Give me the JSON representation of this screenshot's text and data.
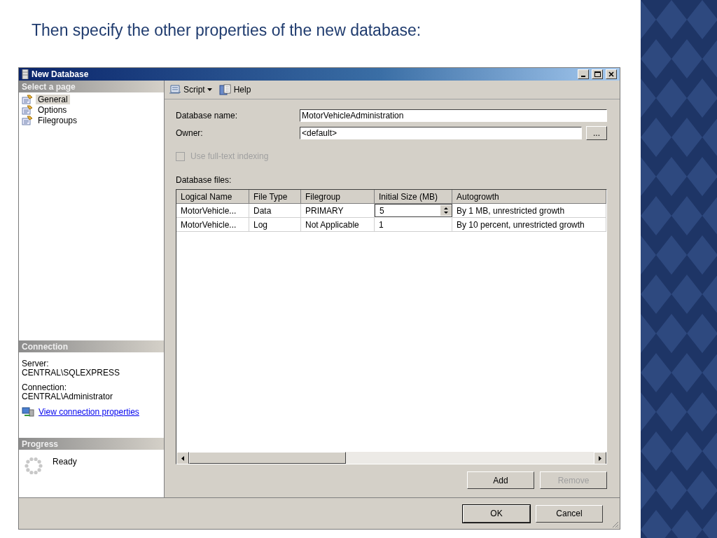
{
  "slide_title": "Then specify the other properties of the new database:",
  "window": {
    "title": "New Database"
  },
  "sidebar": {
    "header": "Select a page",
    "items": [
      {
        "label": "General",
        "selected": true
      },
      {
        "label": "Options",
        "selected": false
      },
      {
        "label": "Filegroups",
        "selected": false
      }
    ]
  },
  "connection": {
    "header": "Connection",
    "entries": [
      {
        "label": "Server:",
        "value": "CENTRAL\\SQLEXPRESS"
      },
      {
        "label": "Connection:",
        "value": "CENTRAL\\Administrator"
      }
    ],
    "link": "View connection properties"
  },
  "progress": {
    "header": "Progress",
    "status": "Ready"
  },
  "toolbar": {
    "items": [
      {
        "label": "Script",
        "kind": "dropdown"
      },
      {
        "label": "Help",
        "kind": "help"
      }
    ]
  },
  "form": {
    "fields": [
      {
        "label": "Database name:",
        "value": "MotorVehicleAdministration",
        "kind": "text"
      },
      {
        "label": "Owner:",
        "value": "<default>",
        "kind": "browse",
        "button": "..."
      }
    ],
    "fulltext": {
      "label": "Use full-text indexing",
      "checked": false,
      "disabled": true
    }
  },
  "files": {
    "label": "Database files:",
    "columns": [
      "Logical Name",
      "File Type",
      "Filegroup",
      "Initial Size (MB)",
      "Autogrowth"
    ],
    "rows": [
      {
        "cells": [
          {
            "text": "MotorVehicle...",
            "kind": "text"
          },
          {
            "text": "Data",
            "kind": "text"
          },
          {
            "text": "PRIMARY",
            "kind": "text"
          },
          {
            "text": "5",
            "kind": "spin"
          },
          {
            "text": "By 1 MB, unrestricted growth",
            "kind": "text"
          }
        ]
      },
      {
        "cells": [
          {
            "text": "MotorVehicle...",
            "kind": "text"
          },
          {
            "text": "Log",
            "kind": "text"
          },
          {
            "text": "Not Applicable",
            "kind": "text"
          },
          {
            "text": "1",
            "kind": "text"
          },
          {
            "text": "By 10 percent, unrestricted growth",
            "kind": "text"
          }
        ]
      }
    ]
  },
  "file_buttons": [
    {
      "label": "Add",
      "disabled": false
    },
    {
      "label": "Remove",
      "disabled": true
    }
  ],
  "dialog_buttons": [
    {
      "label": "OK",
      "default": true
    },
    {
      "label": "Cancel",
      "default": false
    }
  ]
}
